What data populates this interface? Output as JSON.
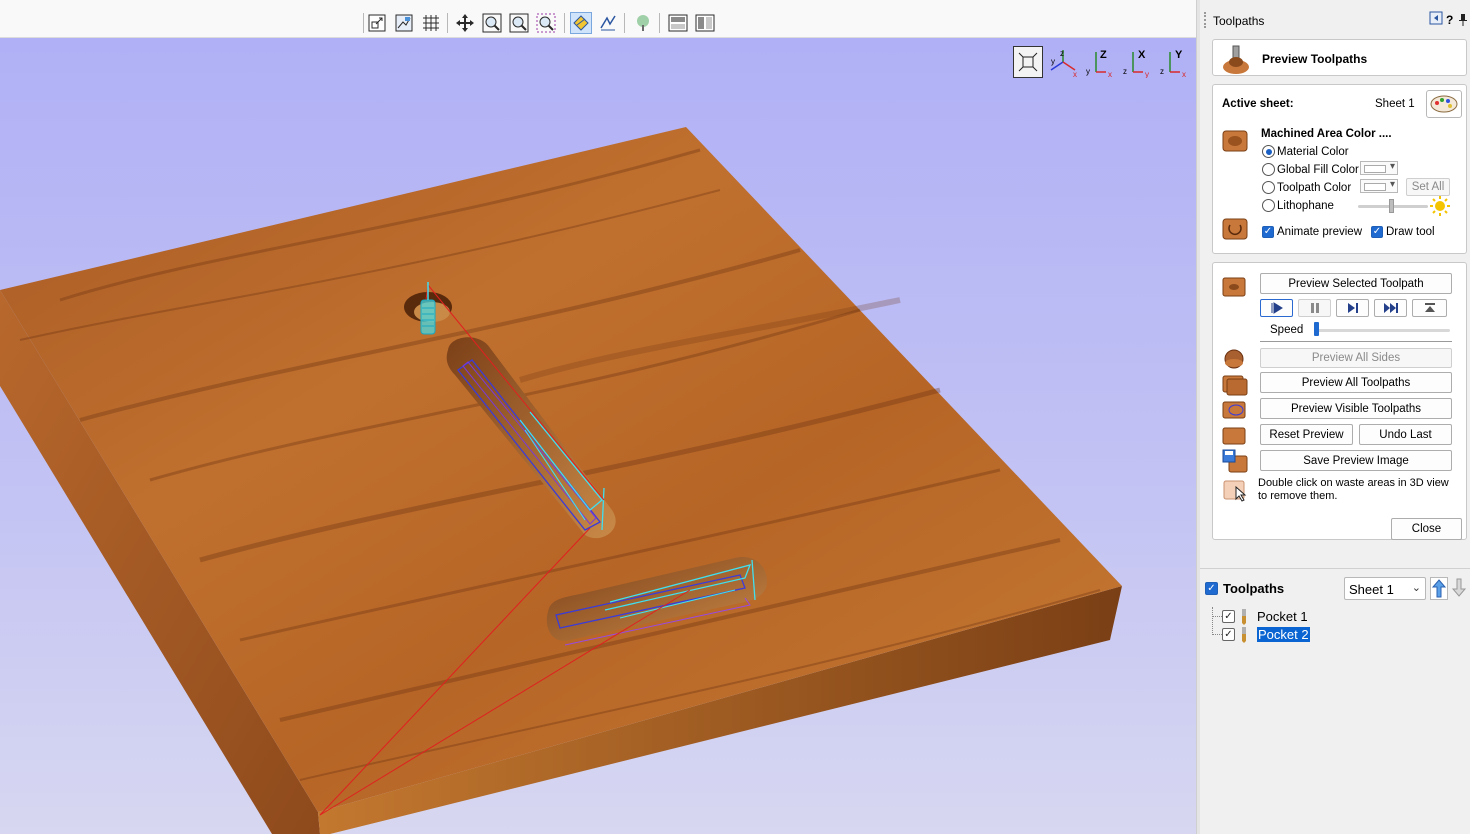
{
  "toolbar": {
    "icons": [
      "scale-view-icon",
      "view-frame-icon",
      "grid-icon",
      "pan-icon",
      "zoom-window-icon",
      "zoom-extents-icon",
      "zoom-selected-icon",
      "render-toolpath-icon",
      "toolpath-link-icon",
      "tree-icon",
      "layout-one-icon",
      "layout-two-icon"
    ]
  },
  "viewport": {
    "view_buttons": [
      "fit-view-icon",
      "iso-view-icon",
      "top-view-icon",
      "front-view-icon",
      "right-view-icon",
      "left-view-icon"
    ],
    "axis_labels": {
      "x": "X",
      "y": "Y",
      "z": "Z"
    }
  },
  "panel": {
    "title": "Toolpaths",
    "header_help": "?",
    "preview": {
      "title": "Preview Toolpaths"
    },
    "sheet": {
      "active_label": "Active sheet:",
      "active_value": "Sheet 1",
      "machined_color_title": "Machined Area Color ....",
      "options": {
        "material": "Material Color",
        "global_fill": "Global Fill Color",
        "toolpath": "Toolpath Color",
        "lithophane": "Lithophane"
      },
      "selected_option": "Material Color",
      "set_all": "Set All",
      "animate_preview": "Animate preview",
      "animate_checked": true,
      "draw_tool": "Draw tool",
      "draw_tool_checked": true
    },
    "controls": {
      "preview_selected": "Preview Selected Toolpath",
      "speed_label": "Speed",
      "speed_level": 0.0,
      "preview_all_sides": "Preview All Sides",
      "preview_all": "Preview All Toolpaths",
      "preview_visible": "Preview Visible Toolpaths",
      "reset": "Reset Preview",
      "undo_last": "Undo Last",
      "save_image": "Save Preview Image",
      "hint": "Double click on waste areas in 3D view to remove them."
    },
    "close": "Close",
    "toolpaths": {
      "label": "Toolpaths",
      "sheet_select": "Sheet 1",
      "items": [
        {
          "name": "Pocket 1",
          "checked": true,
          "selected": false
        },
        {
          "name": "Pocket 2",
          "checked": true,
          "selected": true
        }
      ]
    }
  },
  "colors": {
    "viewport_top": "#b0b0f6",
    "wood": "#b5652a",
    "toolpath_blue": "#3b3bd8",
    "toolpath_cyan": "#40e0f0",
    "rapid_red": "#e02020",
    "accent": "#1f6ad0"
  }
}
